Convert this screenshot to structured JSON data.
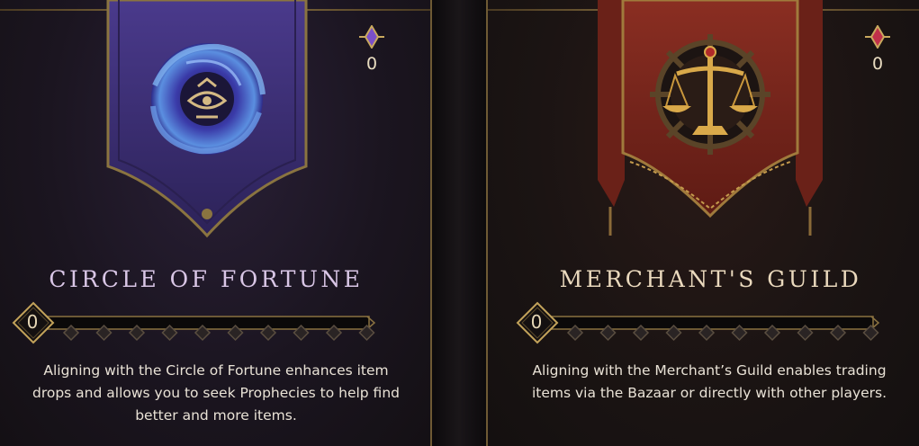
{
  "factions": [
    {
      "title": "CIRCLE OF FORTUNE",
      "currency": "0",
      "level": "0",
      "description": "Aligning with the Circle of Fortune enhances item drops and allows you to seek Prophecies to help find better and more items.",
      "accent": "#d9c6e6",
      "banner_color": "#3f2e78",
      "emblem": "swirl-eye-emblem-icon"
    },
    {
      "title": "MERCHANT'S GUILD",
      "currency": "0",
      "level": "0",
      "description": "Aligning with the Merchant’s Guild enables trading items via the Bazaar or directly with other players.",
      "accent": "#ead9bd",
      "banner_color": "#7a261c",
      "emblem": "scales-wheel-emblem-icon"
    }
  ],
  "progress": {
    "milestones": 10
  },
  "colors": {
    "gold": "#b8964f",
    "background": "#120f12"
  }
}
